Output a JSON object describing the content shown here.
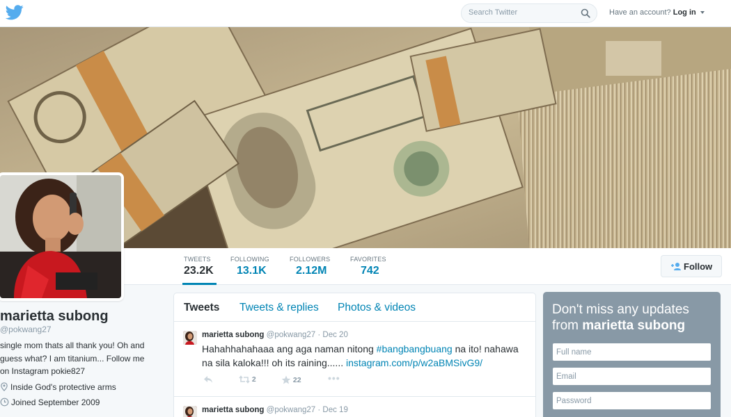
{
  "header": {
    "logo_icon": "twitter-bird-icon",
    "search_placeholder": "Search Twitter",
    "account_prompt": "Have an account?",
    "login_label": "Log in"
  },
  "banner": {
    "description": "Stacks of $100 bills"
  },
  "stats": [
    {
      "label": "TWEETS",
      "value": "23.2K",
      "active": true
    },
    {
      "label": "FOLLOWING",
      "value": "13.1K"
    },
    {
      "label": "FOLLOWERS",
      "value": "2.12M"
    },
    {
      "label": "FAVORITES",
      "value": "742"
    }
  ],
  "follow_button": {
    "label": "Follow"
  },
  "profile": {
    "name": "marietta subong",
    "handle": "@pokwang27",
    "bio_lines": [
      "single mom thats all thank you! Oh and",
      "guess what? I am titanium... Follow me",
      "on Instagram pokie827"
    ],
    "location": "Inside God's protective arms",
    "joined": "Joined September 2009"
  },
  "timeline": {
    "tabs": [
      {
        "label": "Tweets",
        "active": true
      },
      {
        "label": "Tweets & replies"
      },
      {
        "label": "Photos & videos"
      }
    ],
    "tweets": [
      {
        "name": "marietta subong",
        "handle": "@pokwang27",
        "date": "· Dec 20",
        "text_part1": "Hahahhahahaaa ang aga naman nitong ",
        "hashtag": "#bangbangbuang",
        "text_part2": " na ito! nahawa",
        "text_line2": "na sila kaloka!!! oh its raining...... ",
        "link": "instagram.com/p/w2aBMSivG9/",
        "retweets": "2",
        "favorites": "22"
      },
      {
        "name": "marietta subong",
        "handle": "@pokwang27",
        "date": "· Dec 19"
      }
    ]
  },
  "signup": {
    "title_prefix": "Don't miss any updates from",
    "title_name": "marietta subong",
    "fullname_placeholder": "Full name",
    "email_placeholder": "Email",
    "password_placeholder": "Password"
  }
}
